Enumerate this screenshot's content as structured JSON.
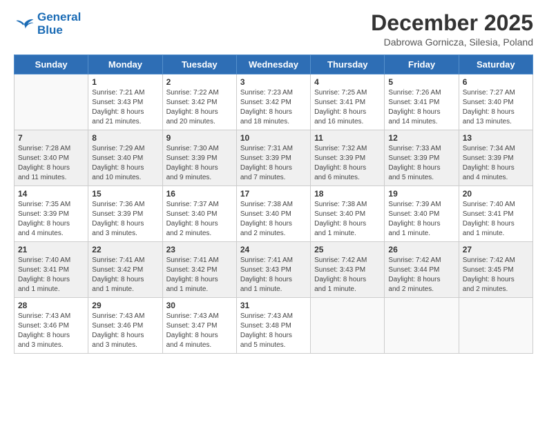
{
  "header": {
    "logo_line1": "General",
    "logo_line2": "Blue",
    "month": "December 2025",
    "location": "Dabrowa Gornicza, Silesia, Poland"
  },
  "days_of_week": [
    "Sunday",
    "Monday",
    "Tuesday",
    "Wednesday",
    "Thursday",
    "Friday",
    "Saturday"
  ],
  "weeks": [
    [
      {
        "day": "",
        "info": ""
      },
      {
        "day": "1",
        "info": "Sunrise: 7:21 AM\nSunset: 3:43 PM\nDaylight: 8 hours\nand 21 minutes."
      },
      {
        "day": "2",
        "info": "Sunrise: 7:22 AM\nSunset: 3:42 PM\nDaylight: 8 hours\nand 20 minutes."
      },
      {
        "day": "3",
        "info": "Sunrise: 7:23 AM\nSunset: 3:42 PM\nDaylight: 8 hours\nand 18 minutes."
      },
      {
        "day": "4",
        "info": "Sunrise: 7:25 AM\nSunset: 3:41 PM\nDaylight: 8 hours\nand 16 minutes."
      },
      {
        "day": "5",
        "info": "Sunrise: 7:26 AM\nSunset: 3:41 PM\nDaylight: 8 hours\nand 14 minutes."
      },
      {
        "day": "6",
        "info": "Sunrise: 7:27 AM\nSunset: 3:40 PM\nDaylight: 8 hours\nand 13 minutes."
      }
    ],
    [
      {
        "day": "7",
        "info": "Sunrise: 7:28 AM\nSunset: 3:40 PM\nDaylight: 8 hours\nand 11 minutes."
      },
      {
        "day": "8",
        "info": "Sunrise: 7:29 AM\nSunset: 3:40 PM\nDaylight: 8 hours\nand 10 minutes."
      },
      {
        "day": "9",
        "info": "Sunrise: 7:30 AM\nSunset: 3:39 PM\nDaylight: 8 hours\nand 9 minutes."
      },
      {
        "day": "10",
        "info": "Sunrise: 7:31 AM\nSunset: 3:39 PM\nDaylight: 8 hours\nand 7 minutes."
      },
      {
        "day": "11",
        "info": "Sunrise: 7:32 AM\nSunset: 3:39 PM\nDaylight: 8 hours\nand 6 minutes."
      },
      {
        "day": "12",
        "info": "Sunrise: 7:33 AM\nSunset: 3:39 PM\nDaylight: 8 hours\nand 5 minutes."
      },
      {
        "day": "13",
        "info": "Sunrise: 7:34 AM\nSunset: 3:39 PM\nDaylight: 8 hours\nand 4 minutes."
      }
    ],
    [
      {
        "day": "14",
        "info": "Sunrise: 7:35 AM\nSunset: 3:39 PM\nDaylight: 8 hours\nand 4 minutes."
      },
      {
        "day": "15",
        "info": "Sunrise: 7:36 AM\nSunset: 3:39 PM\nDaylight: 8 hours\nand 3 minutes."
      },
      {
        "day": "16",
        "info": "Sunrise: 7:37 AM\nSunset: 3:40 PM\nDaylight: 8 hours\nand 2 minutes."
      },
      {
        "day": "17",
        "info": "Sunrise: 7:38 AM\nSunset: 3:40 PM\nDaylight: 8 hours\nand 2 minutes."
      },
      {
        "day": "18",
        "info": "Sunrise: 7:38 AM\nSunset: 3:40 PM\nDaylight: 8 hours\nand 1 minute."
      },
      {
        "day": "19",
        "info": "Sunrise: 7:39 AM\nSunset: 3:40 PM\nDaylight: 8 hours\nand 1 minute."
      },
      {
        "day": "20",
        "info": "Sunrise: 7:40 AM\nSunset: 3:41 PM\nDaylight: 8 hours\nand 1 minute."
      }
    ],
    [
      {
        "day": "21",
        "info": "Sunrise: 7:40 AM\nSunset: 3:41 PM\nDaylight: 8 hours\nand 1 minute."
      },
      {
        "day": "22",
        "info": "Sunrise: 7:41 AM\nSunset: 3:42 PM\nDaylight: 8 hours\nand 1 minute."
      },
      {
        "day": "23",
        "info": "Sunrise: 7:41 AM\nSunset: 3:42 PM\nDaylight: 8 hours\nand 1 minute."
      },
      {
        "day": "24",
        "info": "Sunrise: 7:41 AM\nSunset: 3:43 PM\nDaylight: 8 hours\nand 1 minute."
      },
      {
        "day": "25",
        "info": "Sunrise: 7:42 AM\nSunset: 3:43 PM\nDaylight: 8 hours\nand 1 minute."
      },
      {
        "day": "26",
        "info": "Sunrise: 7:42 AM\nSunset: 3:44 PM\nDaylight: 8 hours\nand 2 minutes."
      },
      {
        "day": "27",
        "info": "Sunrise: 7:42 AM\nSunset: 3:45 PM\nDaylight: 8 hours\nand 2 minutes."
      }
    ],
    [
      {
        "day": "28",
        "info": "Sunrise: 7:43 AM\nSunset: 3:46 PM\nDaylight: 8 hours\nand 3 minutes."
      },
      {
        "day": "29",
        "info": "Sunrise: 7:43 AM\nSunset: 3:46 PM\nDaylight: 8 hours\nand 3 minutes."
      },
      {
        "day": "30",
        "info": "Sunrise: 7:43 AM\nSunset: 3:47 PM\nDaylight: 8 hours\nand 4 minutes."
      },
      {
        "day": "31",
        "info": "Sunrise: 7:43 AM\nSunset: 3:48 PM\nDaylight: 8 hours\nand 5 minutes."
      },
      {
        "day": "",
        "info": ""
      },
      {
        "day": "",
        "info": ""
      },
      {
        "day": "",
        "info": ""
      }
    ]
  ]
}
